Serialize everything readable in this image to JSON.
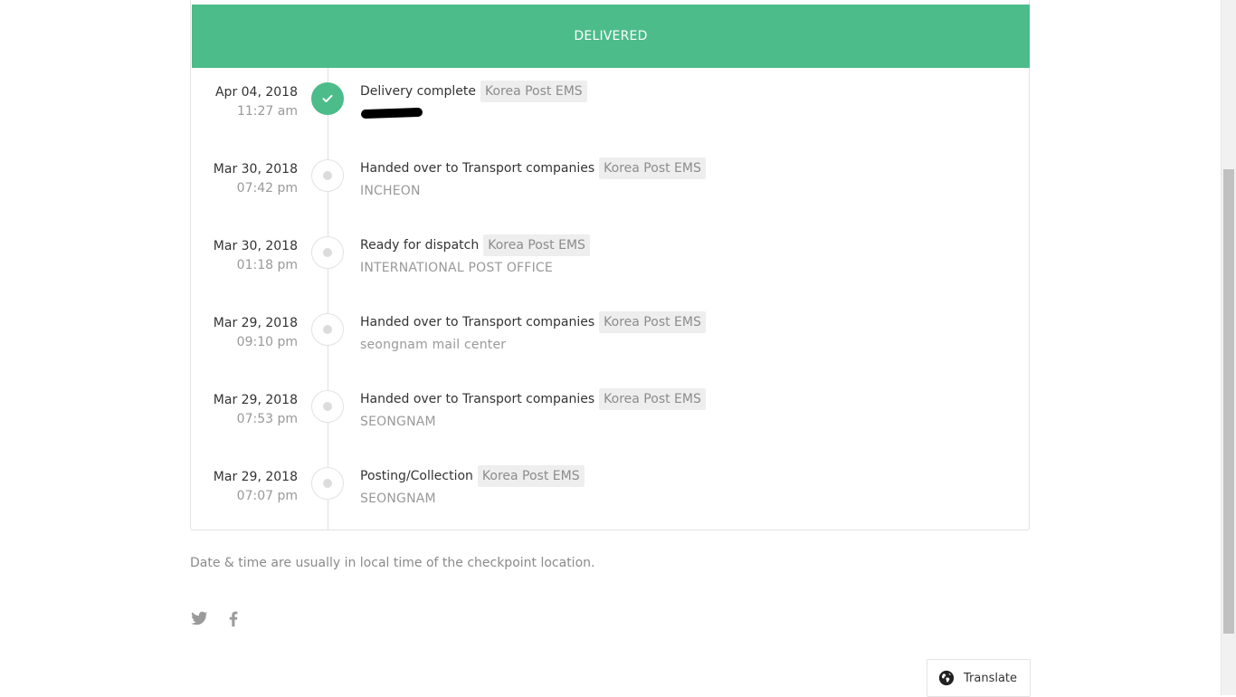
{
  "banner": {
    "status": "DELIVERED"
  },
  "checkpoints": [
    {
      "date": "Apr 04, 2018",
      "time": "11:27 am",
      "status": "Delivery complete",
      "courier": "Korea Post EMS",
      "location": "",
      "complete": true
    },
    {
      "date": "Mar 30, 2018",
      "time": "07:42 pm",
      "status": "Handed over to Transport companies",
      "courier": "Korea Post EMS",
      "location": "INCHEON",
      "complete": false
    },
    {
      "date": "Mar 30, 2018",
      "time": "01:18 pm",
      "status": "Ready for dispatch",
      "courier": "Korea Post EMS",
      "location": "INTERNATIONAL POST OFFICE",
      "complete": false
    },
    {
      "date": "Mar 29, 2018",
      "time": "09:10 pm",
      "status": "Handed over to Transport companies",
      "courier": "Korea Post EMS",
      "location": "seongnam mail center",
      "complete": false
    },
    {
      "date": "Mar 29, 2018",
      "time": "07:53 pm",
      "status": "Handed over to Transport companies",
      "courier": "Korea Post EMS",
      "location": "SEONGNAM",
      "complete": false
    },
    {
      "date": "Mar 29, 2018",
      "time": "07:07 pm",
      "status": "Posting/Collection",
      "courier": "Korea Post EMS",
      "location": "SEONGNAM",
      "complete": false
    }
  ],
  "note": "Date & time are usually in local time of the checkpoint location.",
  "social": {
    "twitter_icon": "twitter-icon",
    "facebook_icon": "facebook-icon"
  },
  "translate": {
    "label": "Translate",
    "icon": "globe-icon"
  },
  "colors": {
    "accent": "#4cbc8a",
    "muted_text": "#999999",
    "badge_bg": "#eeeeee"
  }
}
